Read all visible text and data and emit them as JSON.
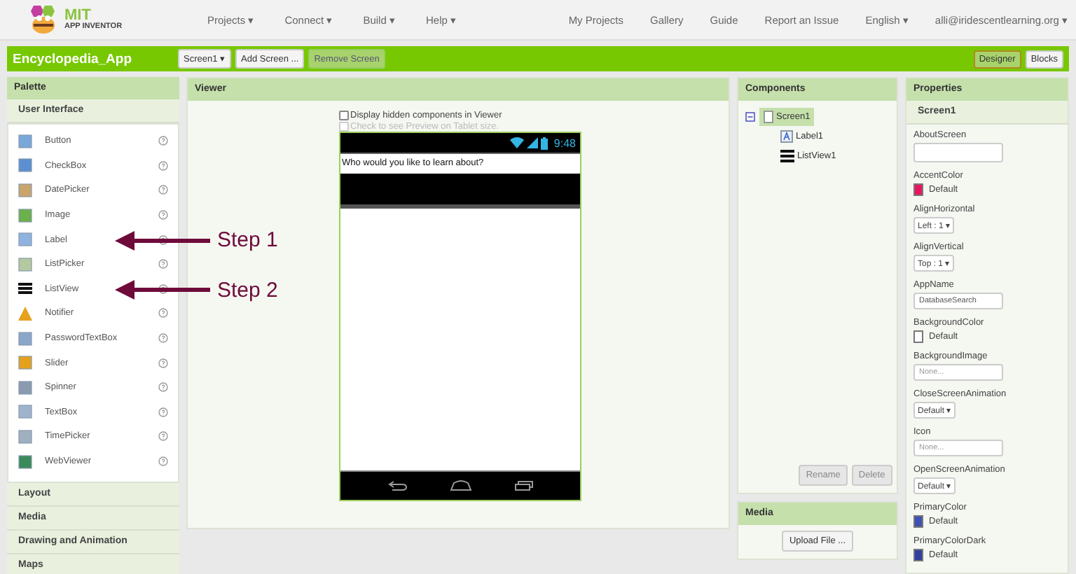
{
  "header": {
    "logo": {
      "title": "MIT",
      "subtitle": "APP INVENTOR"
    },
    "menus": [
      "Projects ▾",
      "Connect ▾",
      "Build ▾",
      "Help ▾"
    ],
    "links": [
      "My Projects",
      "Gallery",
      "Guide",
      "Report an Issue",
      "English ▾",
      "alli@iridescentlearning.org ▾"
    ]
  },
  "project_bar": {
    "name": "Encyclopedia_App",
    "buttons": [
      {
        "label": "Screen1 ▾",
        "disabled": false
      },
      {
        "label": "Add Screen ...",
        "disabled": false
      },
      {
        "label": "Remove Screen",
        "disabled": true
      }
    ],
    "views": [
      {
        "label": "Designer",
        "selected": true
      },
      {
        "label": "Blocks",
        "selected": false
      }
    ]
  },
  "palette": {
    "title": "Palette",
    "categories": [
      {
        "label": "User Interface",
        "expanded": true,
        "items": [
          {
            "label": "Button"
          },
          {
            "label": "CheckBox"
          },
          {
            "label": "DatePicker"
          },
          {
            "label": "Image"
          },
          {
            "label": "Label",
            "annotation": "Step 1"
          },
          {
            "label": "ListPicker"
          },
          {
            "label": "ListView",
            "annotation": "Step 2"
          },
          {
            "label": "Notifier"
          },
          {
            "label": "PasswordTextBox"
          },
          {
            "label": "Slider"
          },
          {
            "label": "Spinner"
          },
          {
            "label": "TextBox"
          },
          {
            "label": "TimePicker"
          },
          {
            "label": "WebViewer"
          }
        ]
      },
      {
        "label": "Layout",
        "expanded": false
      },
      {
        "label": "Media",
        "expanded": false
      },
      {
        "label": "Drawing and Animation",
        "expanded": false
      },
      {
        "label": "Maps",
        "expanded": false
      }
    ]
  },
  "viewer": {
    "title": "Viewer",
    "options": [
      {
        "label": "Display hidden components in Viewer",
        "checked": false,
        "disabled": false
      },
      {
        "label": "Check to see Preview on Tablet size.",
        "checked": false,
        "disabled": true
      }
    ],
    "phone": {
      "time": "9:48",
      "label_text": "Who would you like to learn about?"
    }
  },
  "components": {
    "title": "Components",
    "tree": [
      {
        "name": "Screen1",
        "selected": true,
        "expanded": true,
        "children": [
          {
            "name": "Label1",
            "selected": false
          },
          {
            "name": "ListView1",
            "selected": false
          }
        ]
      }
    ],
    "buttons": [
      {
        "label": "Rename",
        "disabled": true
      },
      {
        "label": "Delete",
        "disabled": true
      }
    ]
  },
  "media": {
    "title": "Media",
    "button": "Upload File ..."
  },
  "properties": {
    "title": "Properties",
    "component": "Screen1",
    "items": [
      {
        "kind": "textarea",
        "label": "AboutScreen"
      },
      {
        "kind": "color",
        "label": "AccentColor",
        "value": "Default",
        "color": "#e8175d"
      },
      {
        "kind": "dropdown",
        "label": "AlignHorizontal",
        "value": "Left : 1 ▾"
      },
      {
        "kind": "dropdown",
        "label": "AlignVertical",
        "value": "Top : 1 ▾"
      },
      {
        "kind": "text",
        "label": "AppName",
        "value": "DatabaseSearch"
      },
      {
        "kind": "color",
        "label": "BackgroundColor",
        "value": "Default",
        "color": "#ffffff"
      },
      {
        "kind": "text",
        "label": "BackgroundImage",
        "placeholder": "None..."
      },
      {
        "kind": "dropdown",
        "label": "CloseScreenAnimation",
        "value": "Default ▾"
      },
      {
        "kind": "text",
        "label": "Icon",
        "placeholder": "None..."
      },
      {
        "kind": "dropdown",
        "label": "OpenScreenAnimation",
        "value": "Default ▾"
      },
      {
        "kind": "color",
        "label": "PrimaryColor",
        "value": "Default",
        "color": "#3f51b5"
      },
      {
        "kind": "color",
        "label": "PrimaryColorDark",
        "value": "Default",
        "color": "#303f9f"
      }
    ]
  }
}
